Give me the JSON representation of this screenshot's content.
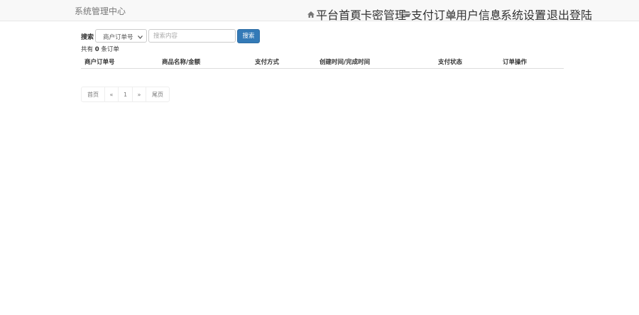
{
  "navbar": {
    "brand": "系统管理中心",
    "items": [
      {
        "label": "平台首页",
        "icon": "home-icon"
      },
      {
        "label": "卡密管理",
        "icon": "grid-icon",
        "dropdown": true
      },
      {
        "label": "支付订单",
        "icon": "card-icon"
      },
      {
        "label": "用户信息",
        "icon": "user-icon"
      },
      {
        "label": "系统设置",
        "icon": "gear-icon"
      },
      {
        "label": "退出登陆",
        "icon": "logout-icon"
      }
    ]
  },
  "search": {
    "label": "搜索",
    "select_value": "商户订单号",
    "placeholder": "搜索内容",
    "button_label": "搜索"
  },
  "total": {
    "prefix": "共有",
    "count": "0",
    "suffix": "条订单"
  },
  "table": {
    "headers": [
      "商户订单号",
      "商品名称/金额",
      "支付方式",
      "创建时间/完成时间",
      "支付状态",
      "订单操作"
    ]
  },
  "pagination": {
    "first": "首页",
    "prev": "«",
    "current": "1",
    "next": "»",
    "last": "尾页"
  },
  "colors": {
    "primary": "#337ab7",
    "navbar_bg": "#f8f8f8",
    "nav_text": "#777777"
  }
}
